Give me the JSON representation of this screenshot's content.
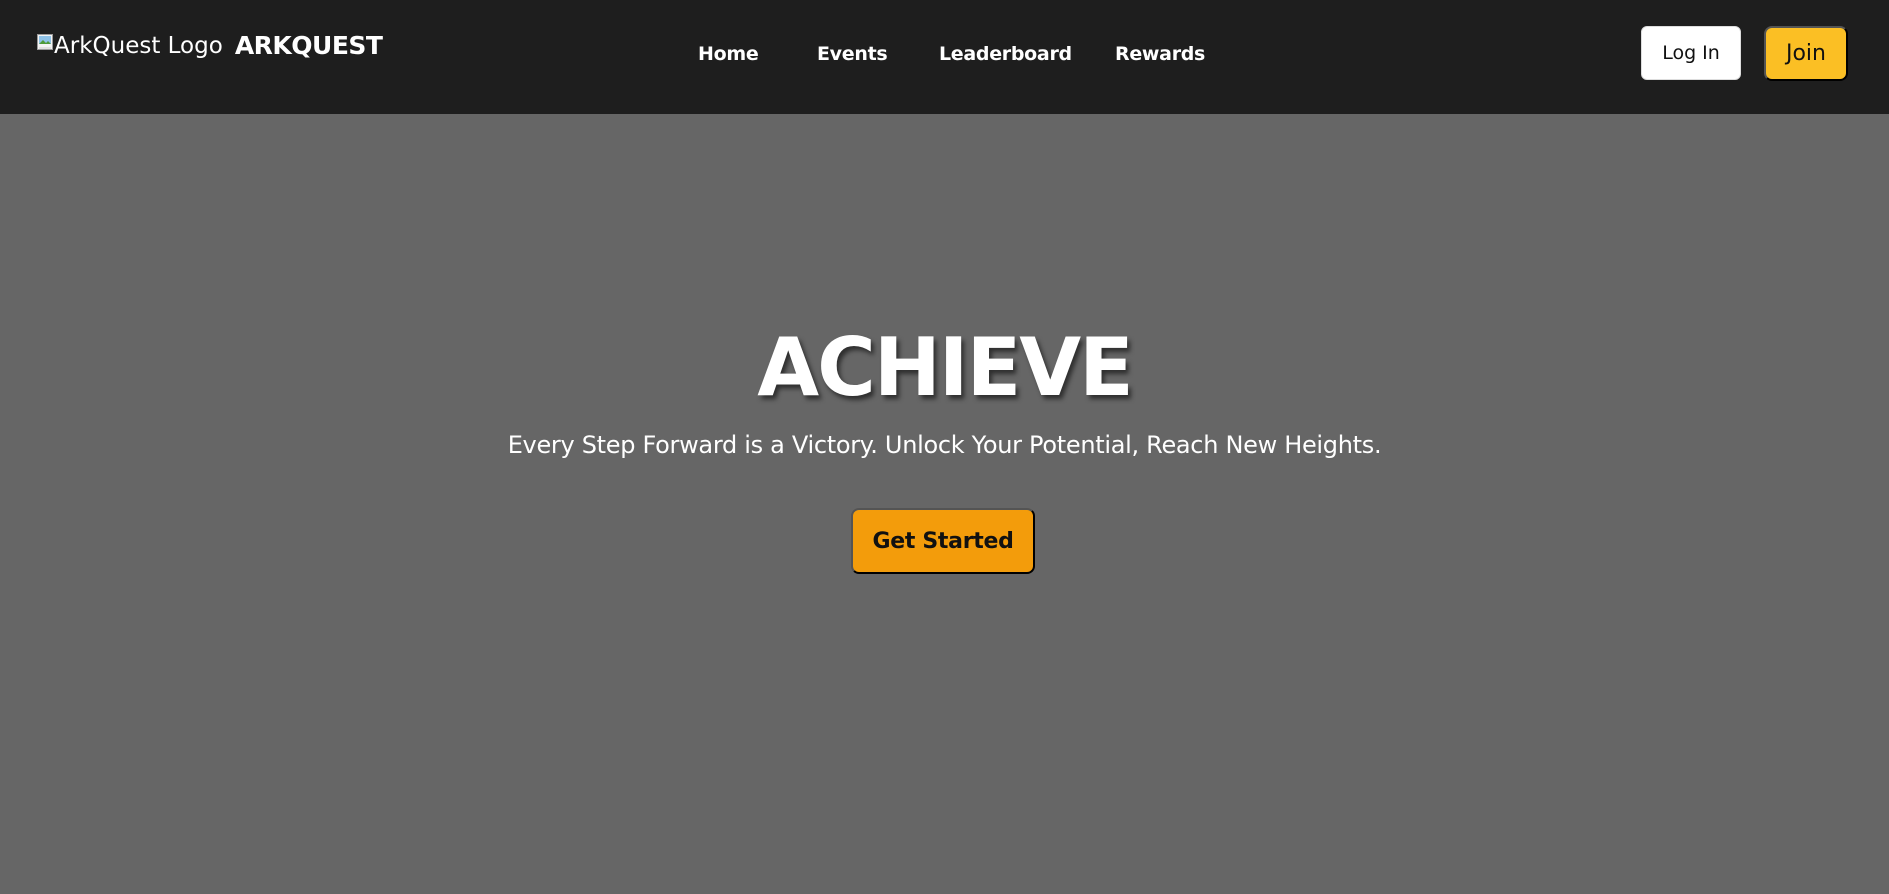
{
  "header": {
    "logo_alt": "ArkQuest Logo",
    "brand_name": "ARKQUEST",
    "nav": [
      {
        "label": "Home"
      },
      {
        "label": "Events"
      },
      {
        "label": "Leaderboard"
      },
      {
        "label": "Rewards"
      }
    ],
    "login_label": "Log In",
    "join_label": "Join"
  },
  "hero": {
    "title": "ACHIEVE",
    "subtitle": "Every Step Forward is a Victory. Unlock Your Potential, Reach New Heights.",
    "cta_label": "Get Started"
  },
  "colors": {
    "navbar_bg": "#1e1e1e",
    "hero_bg": "#666666",
    "join_accent": "#fbbf24",
    "cta_accent": "#f39c0b"
  },
  "icons": {
    "logo": "broken-image-icon"
  }
}
